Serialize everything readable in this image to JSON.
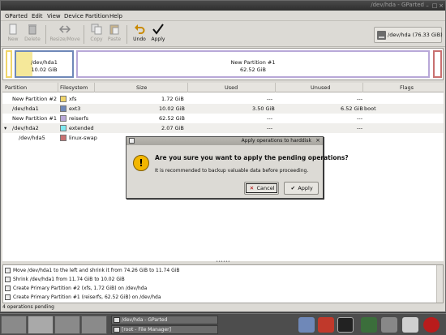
{
  "window": {
    "title": "/dev/hda - GParted",
    "buttons": [
      "–",
      "□",
      "×"
    ]
  },
  "menu": [
    {
      "label": "GParted",
      "name": "menu-gparted"
    },
    {
      "label": "Edit",
      "name": "menu-edit"
    },
    {
      "label": "View",
      "name": "menu-view"
    },
    {
      "label": "Device",
      "name": "menu-device"
    },
    {
      "label": "Partition",
      "name": "menu-partition"
    },
    {
      "label": "Help",
      "name": "menu-help"
    }
  ],
  "toolbar": {
    "new_label": "New",
    "delete_label": "Delete",
    "resize_label": "Resize/Move",
    "copy_label": "Copy",
    "paste_label": "Paste",
    "undo_label": "Undo",
    "apply_label": "Apply",
    "device": "/dev/hda",
    "device_size": "(76.33 GiB)"
  },
  "diskmap": {
    "p1_name": "/dev/hda1",
    "p1_size": "10.02 GiB",
    "p2_name": "New Partition #1",
    "p2_size": "62.52 GiB"
  },
  "table": {
    "headers": [
      "Partition",
      "Filesystem",
      "Size",
      "Used",
      "Unused",
      "Flags"
    ],
    "rows": [
      {
        "partition": "New Partition #2",
        "filesystem": "xfs",
        "color": "#f0d56a",
        "size": "1.72 GiB",
        "used": "---",
        "unused": "---",
        "flags": ""
      },
      {
        "partition": "/dev/hda1",
        "filesystem": "ext3",
        "color": "#6f88b8",
        "size": "10.02 GiB",
        "used": "3.50 GiB",
        "unused": "6.52 GiB",
        "flags": "boot"
      },
      {
        "partition": "New Partition #1",
        "filesystem": "reiserfs",
        "color": "#b8a8d8",
        "size": "62.52 GiB",
        "used": "---",
        "unused": "---",
        "flags": ""
      },
      {
        "partition": "/dev/hda2",
        "filesystem": "extended",
        "color": "#7ee8f0",
        "size": "2.07 GiB",
        "used": "---",
        "unused": "---",
        "flags": ""
      },
      {
        "partition": "/dev/hda5",
        "filesystem": "linux-swap",
        "color": "#c87070",
        "size": "",
        "used": "",
        "unused": "",
        "flags": ""
      }
    ]
  },
  "dialog": {
    "title": "Apply operations to harddisk",
    "question": "Are you sure you want to apply the pending operations?",
    "message": "It is recommended to backup valuable data before proceeding.",
    "cancel_label": "Cancel",
    "apply_label": "Apply",
    "close": "×"
  },
  "operations": [
    "Move /dev/hda1 to the left and shrink it from 74.26 GiB to 11.74 GiB",
    "Shrink /dev/hda1 from 11.74 GiB to 10.02 GiB",
    "Create Primary Partition #2 (xfs, 1.72 GiB) on /dev/hda",
    "Create Primary Partition #1 (reiserfs, 62.52 GiB) on /dev/hda"
  ],
  "status": "4 operations pending",
  "taskbar": {
    "tasks": [
      "/dev/hda - GParted",
      "[root - File Manager]"
    ]
  },
  "colors": {
    "accent_yellow": "#f2b600",
    "ext3": "#6f88b8",
    "reiserfs": "#b8a8d8",
    "unallocated": "#aaaaaa"
  }
}
